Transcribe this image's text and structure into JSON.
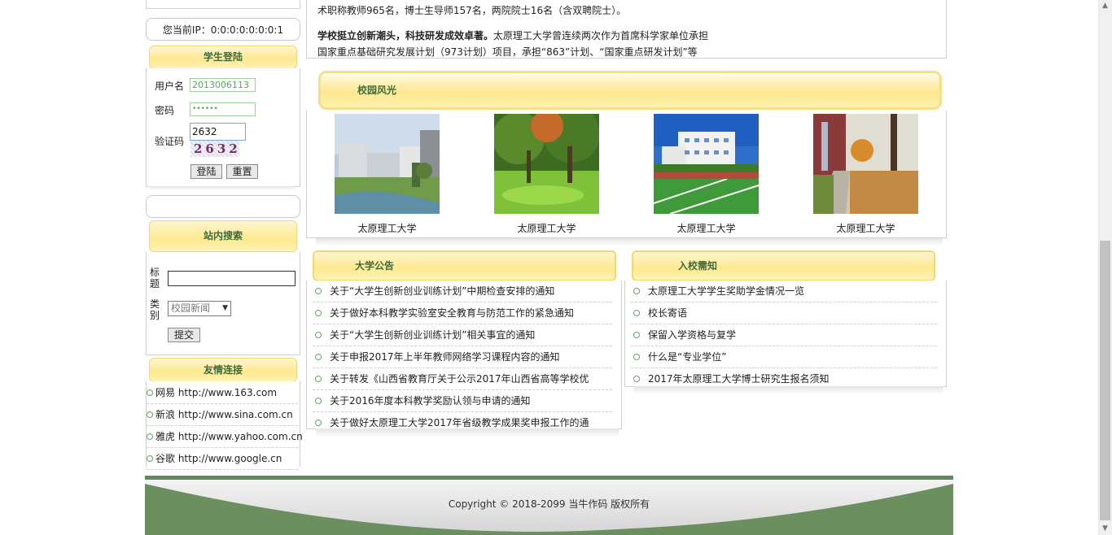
{
  "sidebar": {
    "ip_text": "您当前IP：0:0:0:0:0:0:0:1",
    "login": {
      "title": "学生登陆",
      "username_label": "用户名",
      "username_value": "2013006113",
      "password_label": "密码",
      "password_value": "••••••",
      "captcha_label": "验证码",
      "captcha_value": "2632",
      "captcha_image_text": "2632",
      "login_button": "登陆",
      "reset_button": "重置"
    },
    "search": {
      "title": "站内搜索",
      "title_label_1": "标",
      "title_label_2": "题",
      "category_label_1": "类",
      "category_label_2": "别",
      "category_selected": "校园新闻",
      "submit_button": "提交"
    },
    "links": {
      "title": "友情连接",
      "items": [
        "网易 http://www.163.com",
        "新浪 http://www.sina.com.cn",
        "雅虎 http://www.yahoo.com.cn",
        "谷歌 http://www.google.cn"
      ]
    }
  },
  "intro": {
    "line1": "术职称教师965名，博士生导师157名，两院院士16名（含双聘院士）。",
    "line2_bold": "学校挺立创新潮头，科技研发成效卓著。",
    "line2_rest": "太原理工大学曾连续两次作为首席科学家单位承担",
    "line3": "国家重点基础研究发展计划（973计划）项目，承担“863”计划、“国家重点研发计划”等"
  },
  "campus": {
    "title": "校园风光",
    "captions": [
      "太原理工大学",
      "太原理工大学",
      "太原理工大学",
      "太原理工大学"
    ]
  },
  "announcements": {
    "title": "大学公告",
    "items": [
      "关于“大学生创新创业训练计划”中期检查安排的通知",
      "关于做好本科教学实验室安全教育与防范工作的紧急通知",
      "关于“大学生创新创业训练计划”相关事宜的通知",
      "关于申报2017年上半年教师网络学习课程内容的通知",
      "关于转发《山西省教育厅关于公示2017年山西省高等学校优",
      "关于2016年度本科教学奖励认领与申请的通知",
      "关于做好太原理工大学2017年省级教学成果奖申报工作的通"
    ]
  },
  "admission": {
    "title": "入校需知",
    "items": [
      "太原理工大学学生奖助学金情况一览",
      "校长寄语",
      "保留入学资格与复学",
      "什么是“专业学位”",
      "2017年太原理工大学博士研究生报名须知"
    ]
  },
  "footer": {
    "copyright": "Copyright © 2018-2099 当牛作码 版权所有"
  },
  "colors": {
    "accent_green": "#5e8b5e",
    "header_yellow": "#fde98f",
    "header_text": "#3f6b3f"
  }
}
